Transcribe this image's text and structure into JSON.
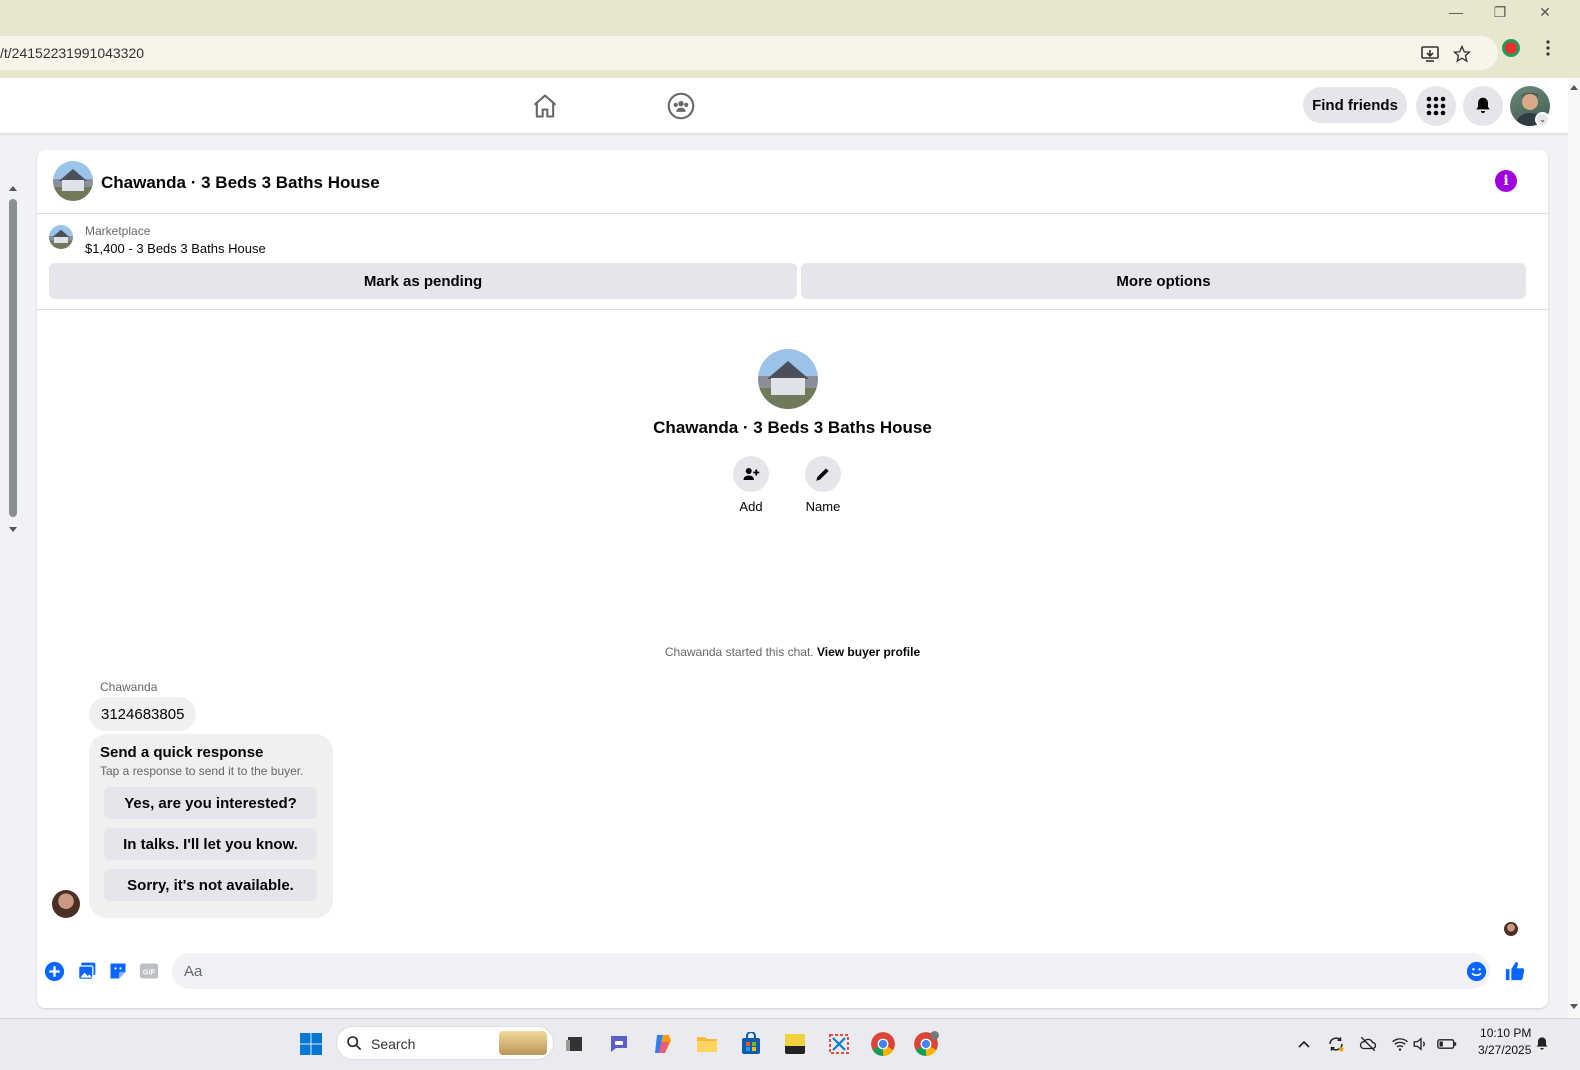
{
  "browser": {
    "url": "/t/24152231991043320"
  },
  "nav": {
    "find_friends_label": "Find friends"
  },
  "chat": {
    "title": "Chawanda · 3 Beds 3 Baths House",
    "marketplace_label": "Marketplace",
    "listing": "$1,400 - 3 Beds 3 Baths House",
    "mark_pending_label": "Mark as pending",
    "more_options_label": "More options",
    "center_title": "Chawanda · 3 Beds 3 Baths House",
    "add_label": "Add",
    "name_label": "Name",
    "started_text": "Chawanda started this chat.",
    "view_profile_link": "View buyer profile",
    "sender_name": "Chawanda",
    "message": "3124683805",
    "quick_response": {
      "title": "Send a quick response",
      "subtitle": "Tap a response to send it to the buyer.",
      "options": [
        "Yes, are you interested?",
        "In talks. I'll let you know.",
        "Sorry, it's not available."
      ]
    },
    "composer_placeholder": "Aa"
  },
  "colors": {
    "facebook_blue": "#0866ff",
    "info_purple": "#a000e0"
  },
  "taskbar": {
    "search_label": "Search",
    "time": "10:10 PM",
    "date": "3/27/2025"
  }
}
